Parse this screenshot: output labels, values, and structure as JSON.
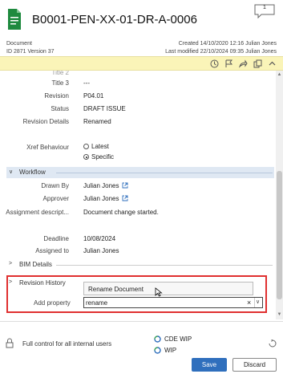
{
  "header": {
    "title": "B0001-PEN-XX-01-DR-A-0006",
    "comment_count": "1",
    "type_label": "Document",
    "id_version": "ID 2871  Version 37",
    "created": "Created 14/10/2020 12:16 Julian Jones",
    "modified": "Last modified 22/10/2024 09:35 Julian Jones"
  },
  "fields": {
    "title3": {
      "label": "Title 3",
      "value": "---"
    },
    "revision": {
      "label": "Revision",
      "value": "P04.01"
    },
    "status": {
      "label": "Status",
      "value": "DRAFT ISSUE"
    },
    "revision_details": {
      "label": "Revision Details",
      "value": "Renamed"
    },
    "xref_behaviour": {
      "label": "Xref Behaviour",
      "option_latest": "Latest",
      "option_specific": "Specific",
      "selected": "Specific"
    }
  },
  "workflow": {
    "section_title": "Workflow",
    "drawn_by": {
      "label": "Drawn By",
      "value": "Julian Jones"
    },
    "approver": {
      "label": "Approver",
      "value": "Julian Jones"
    },
    "assignment": {
      "label": "Assignment descript...",
      "value": "Document change started."
    },
    "deadline": {
      "label": "Deadline",
      "value": "10/08/2024"
    },
    "assigned_to": {
      "label": "Assigned to",
      "value": "Julian Jones"
    }
  },
  "sections": {
    "bim_details": "BIM Details",
    "revision_history": "Revision History"
  },
  "add_property": {
    "label": "Add property",
    "input_value": "rename",
    "suggestion": "Rename Document"
  },
  "footer": {
    "permission_text": "Full control for all internal users",
    "state_cde": "CDE WIP",
    "state_wip": "WIP",
    "save_label": "Save",
    "discard_label": "Discard"
  },
  "colors": {
    "toolbar_bg": "#faf4b8",
    "accent": "#2f6fbd",
    "highlight": "#e03030",
    "doc_icon": "#1e8a3e"
  }
}
